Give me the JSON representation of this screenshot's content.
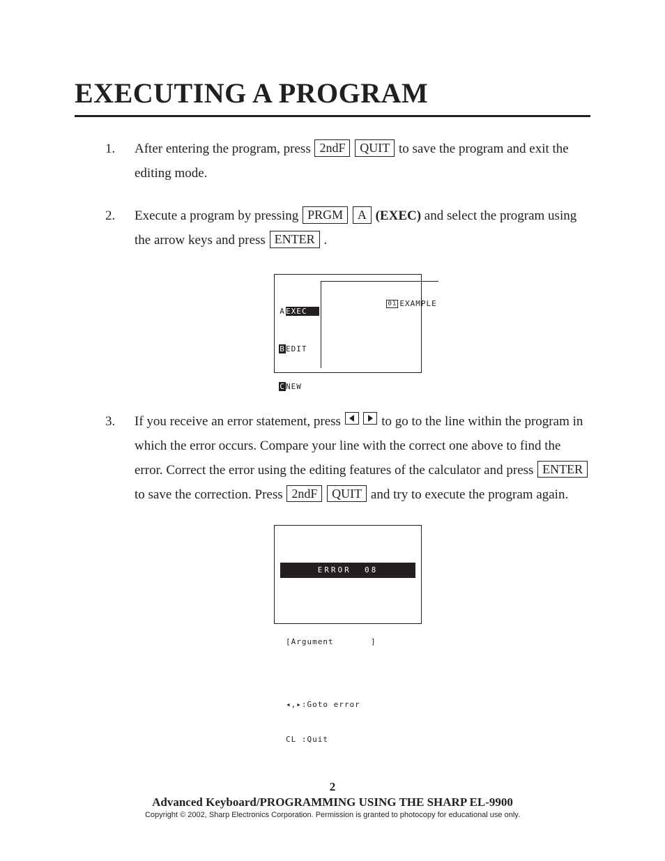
{
  "title": "EXECUTING A PROGRAM",
  "steps": {
    "s1": {
      "num": "1.",
      "t1": "After entering the program, press ",
      "k1": "2ndF",
      "k2": "QUIT",
      "t2": " to save the program and exit the editing mode."
    },
    "s2": {
      "num": "2.",
      "t1": "Execute a program by pressing ",
      "k1": "PRGM",
      "k2": "A",
      "exec": "(EXEC)",
      "t2": " and select the program using the arrow keys and press ",
      "k3": "ENTER",
      "t3": " ."
    },
    "s3": {
      "num": "3.",
      "t1": "If you receive an error statement, press ",
      "t2": " to go to the line within the program in which the error occurs.  Compare your line with the correct one above to find the error.  Correct the error using the editing features of the calculator and press ",
      "k1": "ENTER",
      "t3": " to save the correction. Press ",
      "k2": "2ndF",
      "k3": "QUIT",
      "t4": " and try to execute the program again."
    }
  },
  "lcd": {
    "prgm": {
      "menuA_letter": "A",
      "menuA_text": "EXEC",
      "menuB_letter": "B",
      "menuB_text": "EDIT",
      "menuC_letter": "C",
      "menuC_text": "NEW",
      "list_idx": "01",
      "list_name": "EXAMPLE"
    },
    "err": {
      "title": "ERROR  08",
      "line1": "[Argument       ]",
      "line2": "◂,▸:Goto error",
      "line3": "CL :Quit"
    }
  },
  "footer": {
    "page": "2",
    "series": "Advanced Keyboard/PROGRAMMING USING THE SHARP EL-9900",
    "copy": "Copyright © 2002, Sharp Electronics Corporation.  Permission is granted to photocopy for educational use only."
  }
}
